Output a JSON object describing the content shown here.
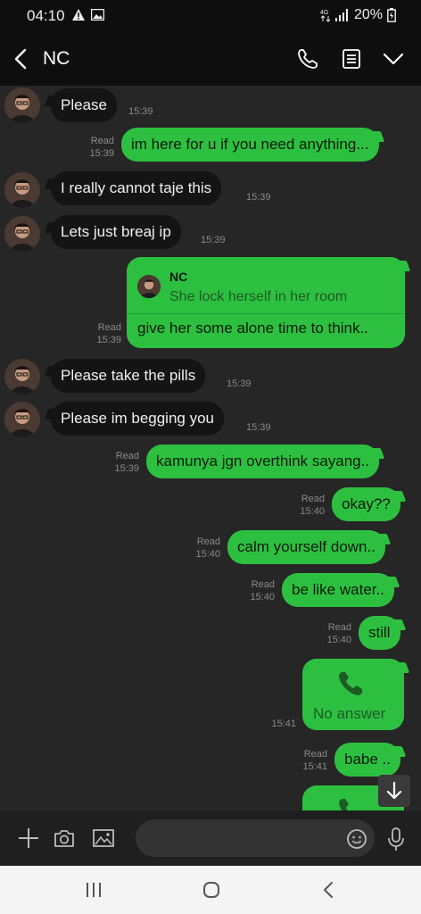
{
  "status_bar": {
    "time": "04:10",
    "battery": "20%",
    "icons": [
      "warning-icon",
      "image-icon",
      "data-arrows-icon",
      "signal-icon",
      "battery-icon"
    ]
  },
  "header": {
    "title": "NC",
    "icons": [
      "back-icon",
      "phone-icon",
      "notes-icon",
      "chevron-down-icon"
    ]
  },
  "messages": [
    {
      "dir": "in",
      "text": "Please",
      "time": "15:39"
    },
    {
      "dir": "out",
      "text": "im here for u if you need anything...",
      "read": "Read",
      "time": "15:39"
    },
    {
      "dir": "in",
      "text": "I really cannot taje this",
      "time": "15:39"
    },
    {
      "dir": "in",
      "text": "Lets just breaj ip",
      "time": "15:39"
    },
    {
      "dir": "out",
      "type": "reply",
      "quote_name": "NC",
      "quote_text": "She lock herself in her room",
      "text": "give her some alone time to think..",
      "read": "Read",
      "time": "15:39"
    },
    {
      "dir": "in",
      "text": "Please take the pills",
      "time": "15:39"
    },
    {
      "dir": "in",
      "text": "Please im begging you",
      "time": "15:39"
    },
    {
      "dir": "out",
      "text": "kamunya jgn overthink sayang..",
      "read": "Read",
      "time": "15:39"
    },
    {
      "dir": "out",
      "text": "okay??",
      "read": "Read",
      "time": "15:40"
    },
    {
      "dir": "out",
      "text": "calm yourself down..",
      "read": "Read",
      "time": "15:40"
    },
    {
      "dir": "out",
      "text": "be like water..",
      "read": "Read",
      "time": "15:40"
    },
    {
      "dir": "out",
      "text": "still",
      "read": "Read",
      "time": "15:40"
    },
    {
      "dir": "out",
      "type": "call",
      "text": "No answer",
      "time": "15:41"
    },
    {
      "dir": "out",
      "text": "babe ..",
      "read": "Read",
      "time": "15:41"
    },
    {
      "dir": "out",
      "type": "call-partial",
      "text": ""
    }
  ],
  "input_bar": {
    "placeholder": "",
    "icons": [
      "plus-icon",
      "camera-icon",
      "gallery-icon",
      "emoji-icon",
      "microphone-icon"
    ]
  },
  "nav_bar": {
    "icons": [
      "recent-apps-icon",
      "home-icon",
      "back-nav-icon"
    ]
  },
  "colors": {
    "background": "#262626",
    "bar": "#0e0e0e",
    "outgoing_bubble": "#2dc040",
    "incoming_bubble": "#141414",
    "meta_text": "#8a8a8a"
  }
}
